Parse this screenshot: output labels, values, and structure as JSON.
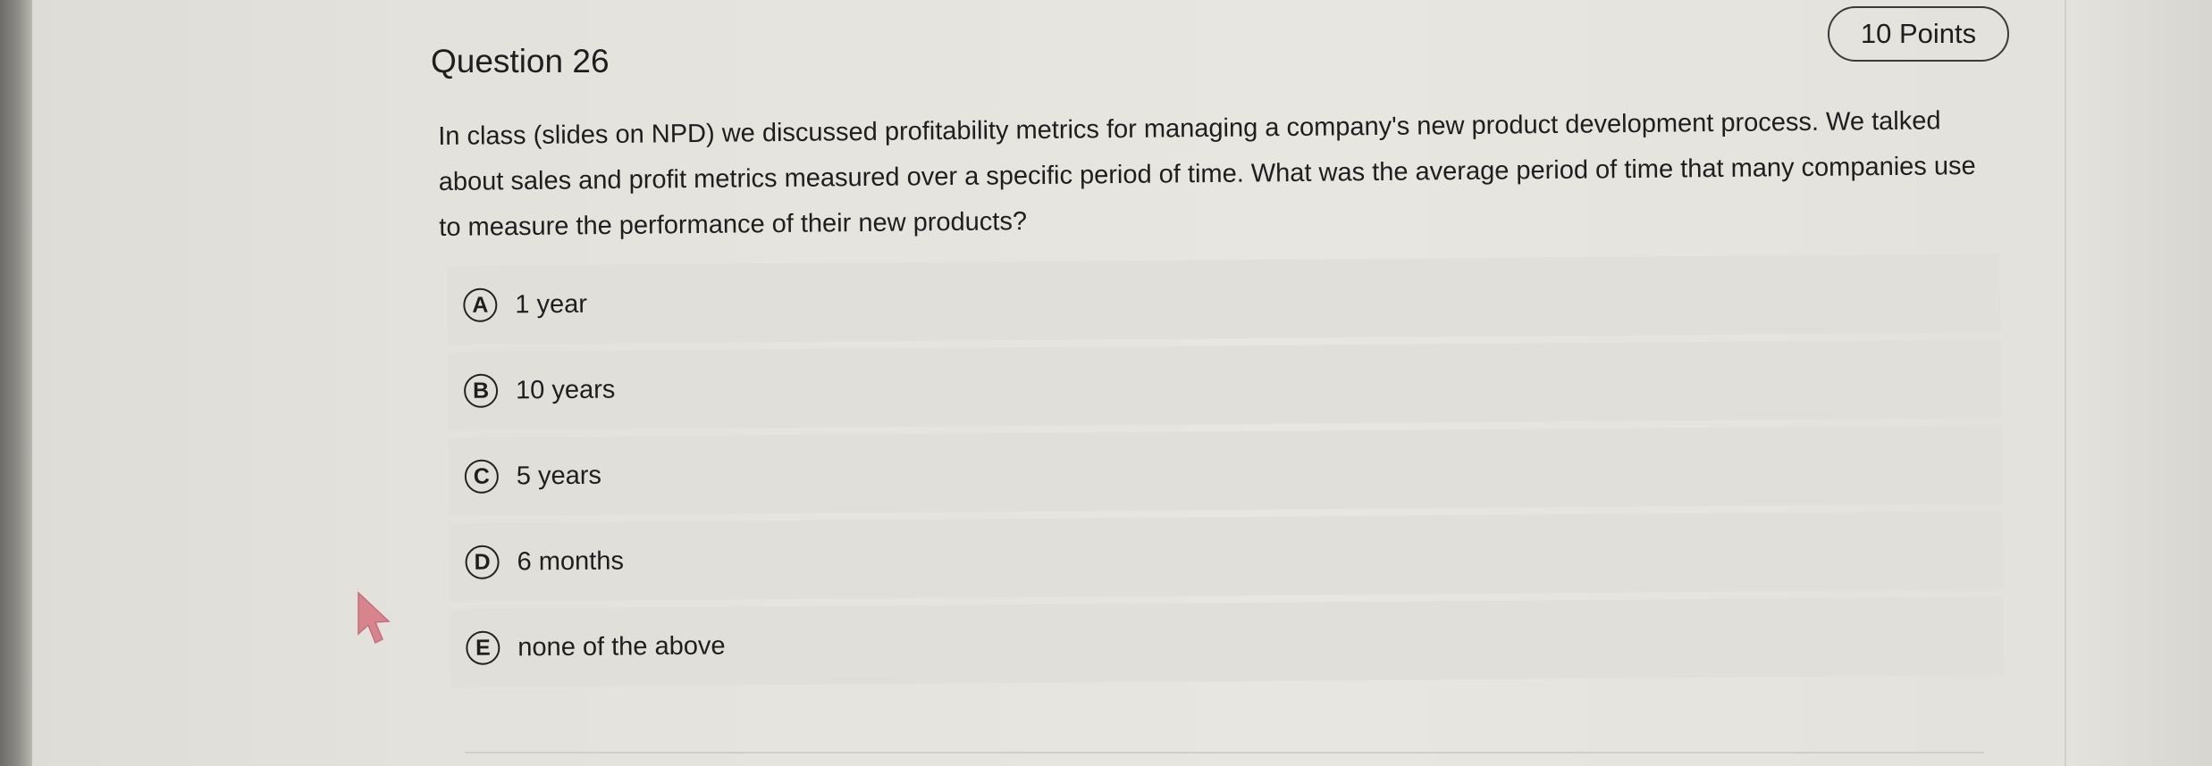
{
  "question": {
    "title": "Question 26",
    "points": "10 Points",
    "text": "In class (slides on NPD) we discussed profitability metrics for managing a company's new product development process. We talked about sales and profit metrics measured over a specific period of time. What was the average period of time that many companies use to measure the performance of their new products?"
  },
  "options": [
    {
      "letter": "A",
      "label": "1 year"
    },
    {
      "letter": "B",
      "label": "10 years"
    },
    {
      "letter": "C",
      "label": "5 years"
    },
    {
      "letter": "D",
      "label": "6 months"
    },
    {
      "letter": "E",
      "label": "none of the above"
    }
  ],
  "icons": {
    "cursor": "mouse-pointer-icon"
  },
  "colors": {
    "cursor": "#d8848f",
    "option_background": "#e1dfd9",
    "page_background": "#e6e4de"
  }
}
